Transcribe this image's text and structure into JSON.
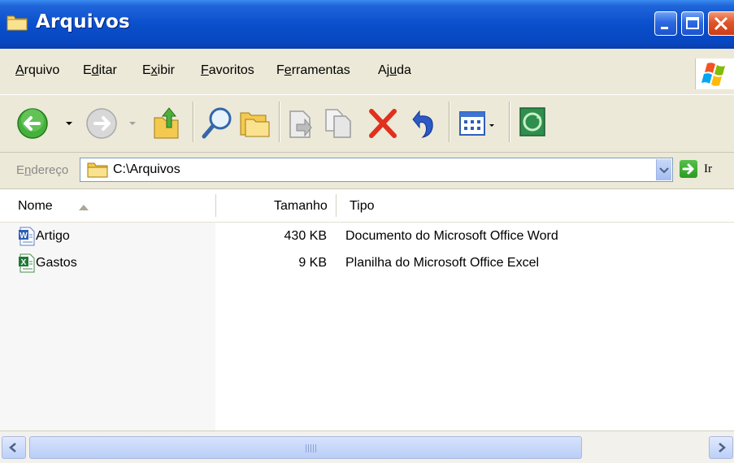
{
  "window": {
    "title": "Arquivos",
    "icon": "folder-icon"
  },
  "menu": {
    "items": [
      {
        "pre": "",
        "key": "A",
        "post": "rquivo"
      },
      {
        "pre": "E",
        "key": "d",
        "post": "itar"
      },
      {
        "pre": "E",
        "key": "x",
        "post": "ibir"
      },
      {
        "pre": "",
        "key": "F",
        "post": "avoritos"
      },
      {
        "pre": "F",
        "key": "e",
        "post": "rramentas"
      },
      {
        "pre": "Aj",
        "key": "u",
        "post": "da"
      }
    ]
  },
  "toolbar": {
    "buttons": [
      "back-icon",
      "forward-icon",
      "up-folder-icon",
      "search-icon",
      "folders-icon",
      "move-to-icon",
      "copy-to-icon",
      "delete-icon",
      "undo-icon",
      "views-icon",
      "sync-icon"
    ]
  },
  "address": {
    "label_pre": "E",
    "label_key": "n",
    "label_post": "dereço",
    "value": "C:\\Arquivos",
    "go_label": "Ir"
  },
  "columns": {
    "name": "Nome",
    "size": "Tamanho",
    "type": "Tipo"
  },
  "files": [
    {
      "name": "Artigo",
      "size": "430 KB",
      "type": "Documento do Microsoft Office Word",
      "icon": "word-document-icon"
    },
    {
      "name": "Gastos",
      "size": "9 KB",
      "type": "Planilha do Microsoft Office Excel",
      "icon": "excel-spreadsheet-icon"
    }
  ],
  "colors": {
    "titlebar": "#0a4fcc",
    "chrome": "#ECE9D8",
    "close": "#e0542a"
  }
}
